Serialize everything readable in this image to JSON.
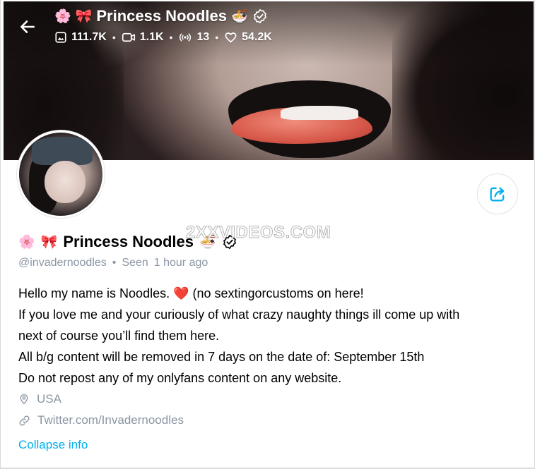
{
  "header": {
    "emoji_flower": "🌸",
    "emoji_bow": "🎀",
    "title": "Princess Noodles",
    "emoji_noodles": "🍜",
    "stats": {
      "photos": "111.7K",
      "videos": "1.1K",
      "streams": "13",
      "likes": "54.2K"
    }
  },
  "profile": {
    "name": "Princess Noodles",
    "handle": "@invadernoodles",
    "seen": "Seen",
    "seen_time": "1 hour ago",
    "bio_lines": [
      "Hello my name is Noodles. ❤️ (no sextingorcustoms on here!",
      "If you love me and your curiously of what crazy naughty things ill come up with",
      "next of course you’ll find them here.",
      "All b/g content will be removed in 7 days on the date of: September 15th",
      "Do not repost any of my onlyfans content on any website."
    ],
    "location": "USA",
    "link": "Twitter.com/Invadernoodles",
    "collapse_label": "Collapse info"
  },
  "watermark": "2XXVIDEOS.COM",
  "icons": {
    "back": "arrow-left-icon",
    "photos": "image-icon",
    "videos": "video-icon",
    "streams": "broadcast-icon",
    "likes": "heart-icon",
    "verified": "verified-badge-icon",
    "share": "share-icon",
    "location": "location-pin-icon",
    "link": "link-icon"
  },
  "colors": {
    "accent": "#00aff0",
    "muted": "#8a96a3",
    "heart": "#e0234e"
  }
}
